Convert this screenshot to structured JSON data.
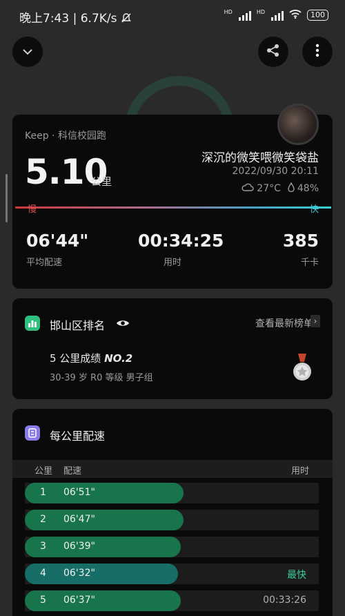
{
  "status_bar": {
    "time": "晚上7:43",
    "speed": "6.7K/s",
    "battery": "100"
  },
  "icons": {
    "collapse": "chevron-down-icon",
    "share": "share-icon",
    "more": "more-vertical-icon"
  },
  "summary": {
    "source": "Keep · 科信校园跑",
    "distance": "5.10",
    "distance_unit": "公里",
    "username": "深沉的微笑喂微笑袋盐",
    "datetime": "2022/09/30 20:11",
    "temperature": "27°C",
    "humidity": "48%",
    "slow_label": "慢",
    "fast_label": "快",
    "stats": [
      {
        "value": "06'44\"",
        "label": "平均配速"
      },
      {
        "value": "00:34:25",
        "label": "用时"
      },
      {
        "value": "385",
        "label": "千卡"
      }
    ]
  },
  "ranking": {
    "title": "邯山区排名",
    "link": "查看最新榜单",
    "result_prefix": "5 公里成绩",
    "result_rank": "NO.2",
    "group": "30-39 岁 R0 等级 男子组"
  },
  "splits": {
    "title": "每公里配速",
    "headers": {
      "km": "公里",
      "pace": "配速",
      "time": "用时"
    },
    "rows": [
      {
        "km": "1",
        "pace": "06'51\"",
        "time": "",
        "fill": 0.54
      },
      {
        "km": "2",
        "pace": "06'47\"",
        "time": "",
        "fill": 0.54
      },
      {
        "km": "3",
        "pace": "06'39\"",
        "time": "",
        "fill": 0.53
      },
      {
        "km": "4",
        "pace": "06'32\"",
        "time": "最快",
        "fill": 0.52
      },
      {
        "km": "5",
        "pace": "06'37\"",
        "time": "00:33:26",
        "fill": 0.53
      }
    ]
  }
}
